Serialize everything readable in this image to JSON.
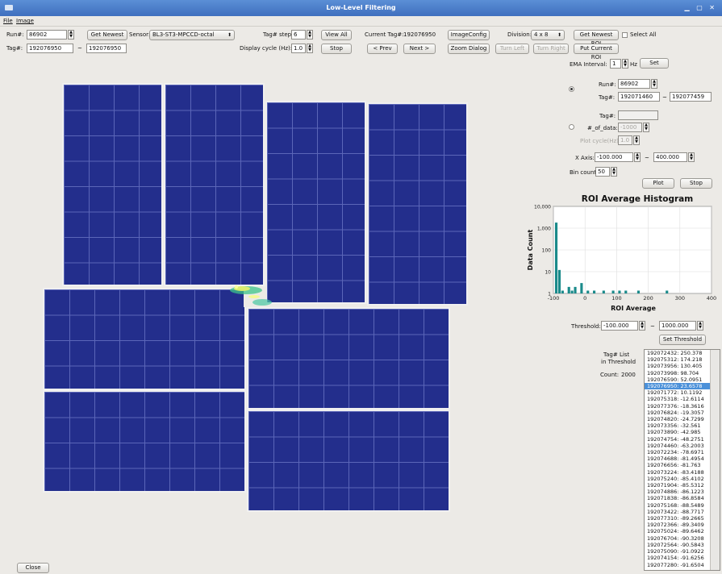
{
  "window": {
    "title": "Low-Level Filtering"
  },
  "menu": {
    "file": "File",
    "image": "Image"
  },
  "toolbar": {
    "run_label": "Run#:",
    "run_value": "86902",
    "get_newest": "Get Newest",
    "sensor_label": "Sensor:",
    "sensor_value": "BL3-ST3-MPCCD-octal",
    "tag_label": "Tag#:",
    "tag_from": "192076950",
    "tag_sep": "~",
    "tag_to": "192076950",
    "tag_step_label": "Tag# step:",
    "tag_step_value": "6",
    "display_cycle_label": "Display cycle (Hz):",
    "display_cycle_value": "1.0",
    "view_all": "View All",
    "stop": "Stop",
    "current_tag_label": "Current Tag#:",
    "current_tag_value": "192076950",
    "prev": "< Prev",
    "next": "Next >",
    "image_config": "ImageConfig",
    "zoom_dialog": "Zoom Dialog",
    "division_label": "Division:",
    "division_value": "4 x 8",
    "turn_left": "Turn Left",
    "turn_right": "Turn Right",
    "get_newest_roi": "Get Newest ROI",
    "select_all": "Select All",
    "put_current_roi": "Put Current ROI"
  },
  "roi_panel": {
    "ema_label": "EMA Interval:",
    "ema_value": "1",
    "hz": "Hz",
    "set": "Set",
    "run_label": "Run#:",
    "run_value": "86902",
    "tag_label": "Tag#:",
    "tag_from": "192071460",
    "tag_sep": "~",
    "tag_to": "192077459",
    "tag2_label": "Tag#:",
    "tag2_value": "",
    "num_data_label": "#_of_data:",
    "num_data_value": "-1000",
    "plot_cycle_label": "Plot cycle(Hz):",
    "plot_cycle_value": "1.0",
    "xaxis_label": "X Axis:",
    "xaxis_from": "-100.000",
    "xaxis_sep": "~",
    "xaxis_to": "400.000",
    "bin_label": "Bin count:",
    "bin_value": "50",
    "plot": "Plot",
    "stop": "Stop",
    "threshold_label": "Threshold:",
    "threshold_from": "-100.000",
    "threshold_sep": "~",
    "threshold_to": "1000.000",
    "set_threshold": "Set Threshold",
    "taglist_label1": "Tag# List",
    "taglist_label2": "in Threshold",
    "count_label": "Count:",
    "count_value": "2000",
    "tag_list": [
      "192072432: 250.378",
      "192075312: 174.218",
      "192073956: 130.405",
      "192073998: 98.704",
      "192076590: 52.0951",
      "192076950: 23.6578",
      "192071772: 10.1192",
      "192075318: -12.6114",
      "192077376: -18.3616",
      "192076824: -19.3057",
      "192074820: -24.7299",
      "192073356: -32.561",
      "192073890: -42.985",
      "192074754: -48.2751",
      "192074460: -63.2003",
      "192072234: -78.6971",
      "192074688: -81.4954",
      "192076656: -81.763",
      "192073224: -83.4188",
      "192075240: -85.4102",
      "192071904: -85.5312",
      "192074886: -86.1223",
      "192071838: -86.8584",
      "192075168: -88.5489",
      "192073422: -88.7717",
      "192077310: -89.2665",
      "192072366: -89.3409",
      "192075024: -89.6462",
      "192076704: -90.3208",
      "192072564: -90.5843",
      "192075090: -91.0922",
      "192074154: -91.6256",
      "192077280: -91.6504"
    ],
    "selected_index": 5
  },
  "close": "Close",
  "chart_data": {
    "type": "bar",
    "title": "ROI Average Histogram",
    "xlabel": "ROI Average",
    "ylabel": "Data Count",
    "xlim": [
      -100,
      400
    ],
    "ylim": [
      1,
      10000
    ],
    "log_y": true,
    "grid": true,
    "x_ticks": [
      "-100",
      "0",
      "100",
      "200",
      "300",
      "400"
    ],
    "y_ticks": [
      "1",
      "10",
      "100",
      "1,000",
      "10,000"
    ],
    "bar_color": "#1a8a8a",
    "x": [
      -90,
      -80,
      -70,
      -60,
      -50,
      -40,
      -30,
      -20,
      -10,
      0,
      10,
      20,
      30,
      40,
      50,
      60,
      70,
      80,
      90,
      100,
      110,
      120,
      130,
      140,
      150,
      160,
      170,
      180,
      190,
      200,
      210,
      220,
      230,
      240,
      250,
      260
    ],
    "values": [
      1800,
      12,
      1,
      0,
      2,
      1,
      2,
      0,
      3,
      0,
      1,
      0,
      1,
      0,
      0,
      1,
      0,
      0,
      1,
      0,
      1,
      0,
      1,
      0,
      0,
      0,
      1,
      0,
      0,
      0,
      0,
      0,
      0,
      0,
      0,
      1
    ]
  }
}
